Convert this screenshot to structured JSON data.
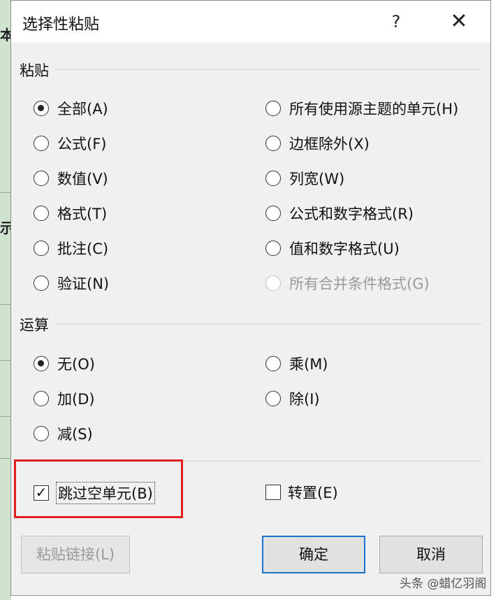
{
  "background": {
    "fragments": [
      "本",
      "示"
    ]
  },
  "dialog": {
    "title": "选择性粘贴",
    "help_label": "?",
    "close_label": "✕",
    "paste_group": {
      "label": "粘贴",
      "left_options": [
        {
          "label": "全部(A)",
          "checked": true
        },
        {
          "label": "公式(F)",
          "checked": false
        },
        {
          "label": "数值(V)",
          "checked": false
        },
        {
          "label": "格式(T)",
          "checked": false
        },
        {
          "label": "批注(C)",
          "checked": false
        },
        {
          "label": "验证(N)",
          "checked": false
        }
      ],
      "right_options": [
        {
          "label": "所有使用源主题的单元(H)",
          "checked": false
        },
        {
          "label": "边框除外(X)",
          "checked": false
        },
        {
          "label": "列宽(W)",
          "checked": false
        },
        {
          "label": "公式和数字格式(R)",
          "checked": false
        },
        {
          "label": "值和数字格式(U)",
          "checked": false
        },
        {
          "label": "所有合并条件格式(G)",
          "checked": false,
          "disabled": true
        }
      ]
    },
    "operation_group": {
      "label": "运算",
      "left_options": [
        {
          "label": "无(O)",
          "checked": true
        },
        {
          "label": "加(D)",
          "checked": false
        },
        {
          "label": "减(S)",
          "checked": false
        }
      ],
      "right_options": [
        {
          "label": "乘(M)",
          "checked": false
        },
        {
          "label": "除(I)",
          "checked": false
        }
      ]
    },
    "skip_blanks": {
      "label": "跳过空单元(B)",
      "checked": true
    },
    "transpose": {
      "label": "转置(E)",
      "checked": false
    },
    "buttons": {
      "paste_link": "粘贴链接(L)",
      "ok": "确定",
      "cancel": "取消"
    },
    "highlight_color": "#e02020",
    "accent_color": "#1b73d1"
  },
  "watermark": "头条 @蜡亿羽阁"
}
